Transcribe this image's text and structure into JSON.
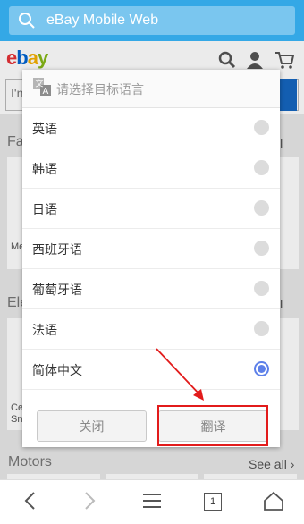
{
  "browser": {
    "url_placeholder": "eBay Mobile Web"
  },
  "ebay": {
    "logo_letters": [
      {
        "ch": "e",
        "color": "#e53238"
      },
      {
        "ch": "b",
        "color": "#0064d2"
      },
      {
        "ch": "a",
        "color": "#f5af02"
      },
      {
        "ch": "y",
        "color": "#86b817"
      }
    ],
    "search_partial": "I'n",
    "sections": [
      {
        "title": "Fa",
        "see_all": "ll"
      },
      {
        "title": "Ele",
        "see_all": "ll"
      },
      {
        "title": "Motors",
        "see_all": "See all"
      }
    ],
    "card_fragments": [
      "Me",
      "Ce",
      "Sn"
    ]
  },
  "dialog": {
    "title": "请选择目标语言",
    "options": [
      {
        "label": "英语",
        "selected": false
      },
      {
        "label": "韩语",
        "selected": false
      },
      {
        "label": "日语",
        "selected": false
      },
      {
        "label": "西班牙语",
        "selected": false
      },
      {
        "label": "葡萄牙语",
        "selected": false
      },
      {
        "label": "法语",
        "selected": false
      },
      {
        "label": "简体中文",
        "selected": true
      }
    ],
    "close_label": "关闭",
    "translate_label": "翻译"
  },
  "bottom_nav": {
    "tab_count": "1"
  },
  "colors": {
    "browser_bar": "#34a8e6",
    "radio_selected": "#5d80e9",
    "annotation": "#e21b1b"
  }
}
